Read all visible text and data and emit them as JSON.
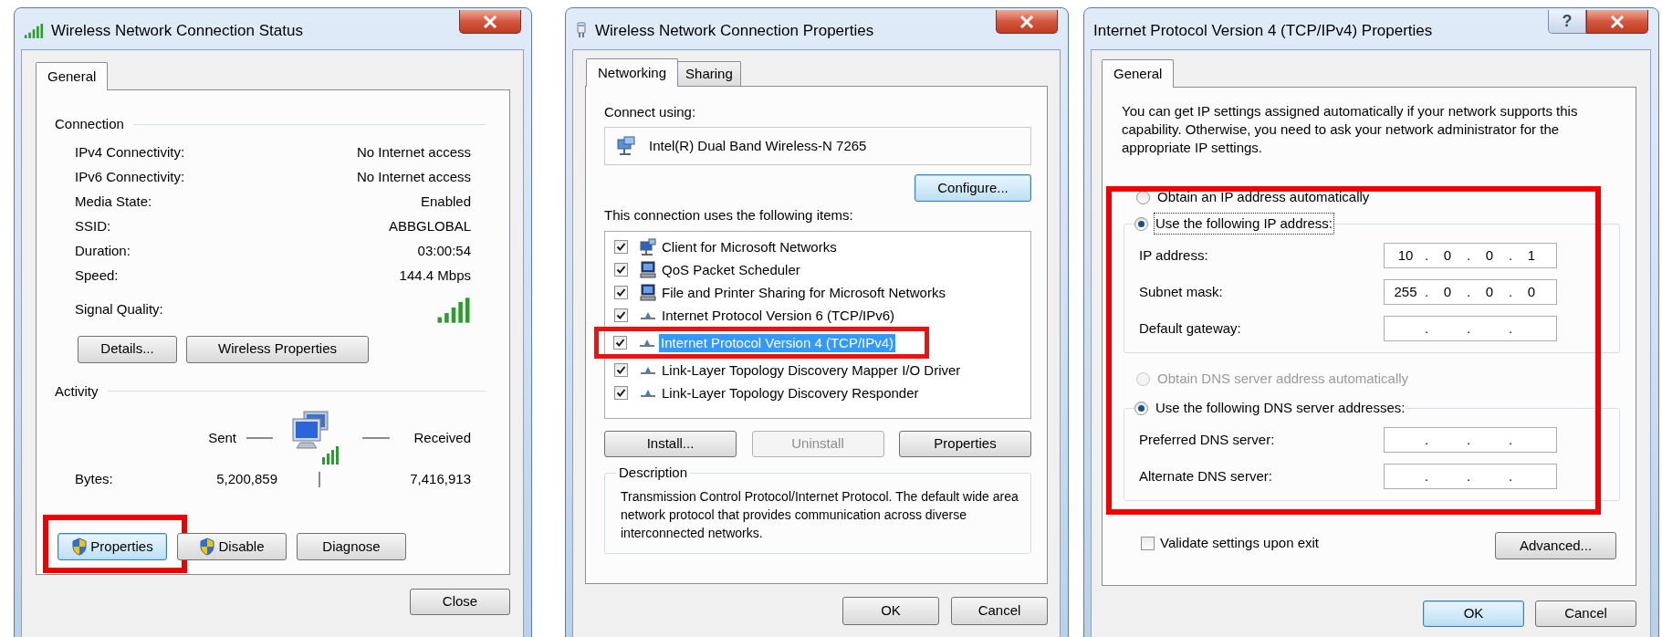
{
  "status_window": {
    "title": "Wireless Network Connection Status",
    "tabs": [
      {
        "label": "General",
        "selected": true
      }
    ],
    "connection": {
      "heading": "Connection",
      "rows": [
        {
          "label": "IPv4 Connectivity:",
          "value": "No Internet access"
        },
        {
          "label": "IPv6 Connectivity:",
          "value": "No Internet access"
        },
        {
          "label": "Media State:",
          "value": "Enabled"
        },
        {
          "label": "SSID:",
          "value": "ABBGLOBAL"
        },
        {
          "label": "Duration:",
          "value": "03:00:54"
        },
        {
          "label": "Speed:",
          "value": "144.4 Mbps"
        }
      ],
      "signal_label": "Signal Quality:"
    },
    "connection_buttons": [
      {
        "label": "Details..."
      },
      {
        "label": "Wireless Properties"
      }
    ],
    "activity": {
      "heading": "Activity",
      "sent_label": "Sent",
      "received_label": "Received",
      "bytes_label": "Bytes:",
      "bytes_sent": "5,200,859",
      "bytes_received": "7,416,913"
    },
    "buttons": [
      {
        "label": "Properties",
        "shield": true,
        "default": true,
        "highlighted": true
      },
      {
        "label": "Disable",
        "shield": true,
        "default": false,
        "highlighted": false
      },
      {
        "label": "Diagnose",
        "shield": false,
        "default": false,
        "highlighted": false
      }
    ],
    "close_button": {
      "label": "Close"
    }
  },
  "properties_window": {
    "title": "Wireless Network Connection Properties",
    "tabs": [
      {
        "label": "Networking",
        "selected": true
      },
      {
        "label": "Sharing",
        "selected": false
      }
    ],
    "connect_using_label": "Connect using:",
    "adapter": "Intel(R) Dual Band Wireless-N 7265",
    "configure_button": {
      "label": "Configure...",
      "default": true
    },
    "items_label": "This connection uses the following items:",
    "items": [
      {
        "kind": "client",
        "label": "Client for Microsoft Networks",
        "checked": true,
        "selected": false,
        "highlighted": false
      },
      {
        "kind": "service",
        "label": "QoS Packet Scheduler",
        "checked": true,
        "selected": false,
        "highlighted": false
      },
      {
        "kind": "service",
        "label": "File and Printer Sharing for Microsoft Networks",
        "checked": true,
        "selected": false,
        "highlighted": false
      },
      {
        "kind": "protocol",
        "label": "Internet Protocol Version 6 (TCP/IPv6)",
        "checked": true,
        "selected": false,
        "highlighted": false
      },
      {
        "kind": "protocol",
        "label": "Internet Protocol Version 4 (TCP/IPv4)",
        "checked": true,
        "selected": true,
        "highlighted": true
      },
      {
        "kind": "protocol",
        "label": "Link-Layer Topology Discovery Mapper I/O Driver",
        "checked": true,
        "selected": false,
        "highlighted": false
      },
      {
        "kind": "protocol",
        "label": "Link-Layer Topology Discovery Responder",
        "checked": true,
        "selected": false,
        "highlighted": false
      }
    ],
    "item_buttons": [
      {
        "label": "Install...",
        "disabled": false
      },
      {
        "label": "Uninstall",
        "disabled": true
      },
      {
        "label": "Properties",
        "disabled": false
      }
    ],
    "description": {
      "heading": "Description",
      "text": "Transmission Control Protocol/Internet Protocol. The default wide area network protocol that provides communication across diverse interconnected networks."
    },
    "buttons": [
      {
        "label": "OK",
        "default": false
      },
      {
        "label": "Cancel",
        "default": false
      }
    ]
  },
  "ipv4_window": {
    "title": "Internet Protocol Version 4 (TCP/IPv4) Properties",
    "help_button": "?",
    "tabs": [
      {
        "label": "General",
        "selected": true
      }
    ],
    "intro": "You can get IP settings assigned automatically if your network supports this capability. Otherwise, you need to ask your network administrator for the appropriate IP settings.",
    "settings_highlighted": true,
    "separator": ".",
    "ip_options": [
      {
        "label": "Obtain an IP address automatically",
        "selected": false,
        "disabled": false,
        "focused": false
      },
      {
        "label": "Use the following IP address:",
        "selected": true,
        "disabled": false,
        "focused": true
      }
    ],
    "ip_fields": [
      {
        "label": "IP address:",
        "octets": [
          "10",
          "0",
          "0",
          "1"
        ]
      },
      {
        "label": "Subnet mask:",
        "octets": [
          "255",
          "0",
          "0",
          "0"
        ]
      },
      {
        "label": "Default gateway:"
      }
    ],
    "dns_options": [
      {
        "label": "Obtain DNS server address automatically",
        "selected": false,
        "disabled": true,
        "focused": false
      },
      {
        "label": "Use the following DNS server addresses:",
        "selected": true,
        "disabled": false,
        "focused": false
      }
    ],
    "dns_fields": [
      {
        "label": "Preferred DNS server:"
      },
      {
        "label": "Alternate DNS server:"
      }
    ],
    "validate": {
      "label": "Validate settings upon exit",
      "checked": false
    },
    "advanced_button": {
      "label": "Advanced..."
    },
    "buttons": [
      {
        "label": "OK",
        "default": true
      },
      {
        "label": "Cancel",
        "default": false
      }
    ]
  }
}
